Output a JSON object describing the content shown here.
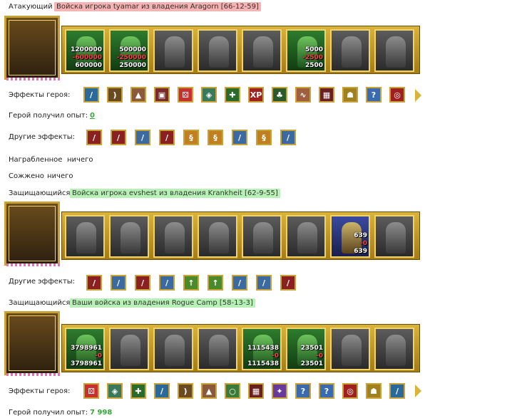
{
  "blocks": [
    {
      "role": "Атакующий",
      "title": "Войска игрока tyamar из владения Aragorn [66-12-59]",
      "tag": "red"
    },
    {
      "role": "Защищающийся",
      "title": "Войска игрока evshest из владения Krankheit [62-9-55]",
      "tag": "green"
    },
    {
      "role": "Защищающийся",
      "title": "Ваши войска из владения Rogue Camp [58-13-3]",
      "tag": "green"
    }
  ],
  "attacker": {
    "stacks": [
      {
        "numbers": [
          "1200000",
          "-600000",
          "600000"
        ]
      },
      {
        "numbers": [
          "500000",
          "-250000",
          "250000"
        ]
      },
      {
        "numbers": []
      },
      {
        "numbers": []
      },
      {
        "numbers": []
      },
      {
        "numbers": [
          "5000",
          "-2500",
          "2500"
        ]
      },
      {
        "numbers": []
      },
      {
        "numbers": []
      }
    ],
    "hero_effects_label": "Эффекты героя:",
    "hero_effects": [
      "sword-icon",
      "bow-icon",
      "boot-icon",
      "chest-icon",
      "dice-icon",
      "shield-icon",
      "shield-plus-icon",
      "xp-icon",
      "tree-icon",
      "horn-icon",
      "armor-icon",
      "amulet-icon",
      "question-icon",
      "chain-icon"
    ],
    "xp_label": "Герой получил опыт:",
    "xp_value": "0",
    "other_effects_label": "Другие эффекты:",
    "other_effects": [
      "sword-red-icon",
      "sword-red-icon",
      "sword-blue-icon",
      "sword-red-icon",
      "scroll-icon",
      "scroll-icon",
      "sword-blue-icon",
      "scroll-icon",
      "sword-blue-icon"
    ],
    "loot_label": "Награбленное",
    "loot_value": "ничего",
    "burned_label": "Сожжено",
    "burned_value": "ничего"
  },
  "defender1": {
    "stacks": [
      {
        "numbers": []
      },
      {
        "numbers": []
      },
      {
        "numbers": []
      },
      {
        "numbers": []
      },
      {
        "numbers": []
      },
      {
        "numbers": []
      },
      {
        "numbers": [
          "639",
          "-0",
          "639"
        ]
      },
      {
        "numbers": []
      }
    ],
    "other_effects_label": "Другие эффекты:",
    "other_effects": [
      "sword-red-icon",
      "sword-blue-icon",
      "sword-red-icon",
      "sword-blue-icon",
      "arrow-icon",
      "arrow-icon",
      "sword-blue-icon",
      "sword-blue-icon",
      "sword-red-icon"
    ]
  },
  "defender2": {
    "stacks": [
      {
        "numbers": [
          "3798961",
          "-0",
          "3798961"
        ]
      },
      {
        "numbers": []
      },
      {
        "numbers": []
      },
      {
        "numbers": []
      },
      {
        "numbers": [
          "1115438",
          "-0",
          "1115438"
        ]
      },
      {
        "numbers": [
          "23501",
          "-0",
          "23501"
        ]
      },
      {
        "numbers": []
      },
      {
        "numbers": []
      }
    ],
    "hero_effects_label": "Эффекты героя:",
    "hero_effects": [
      "dice-icon",
      "shield-icon",
      "shield-plus-icon",
      "sword-icon",
      "bow-icon",
      "boot-icon",
      "ring-icon",
      "armor-icon",
      "spell-icon",
      "question-icon",
      "question-icon",
      "chain-icon",
      "amulet-icon",
      "sword-icon"
    ],
    "xp_label": "Герой получил опыт:",
    "xp_value": "7 998"
  },
  "colors": {
    "gold": "#d9b33a",
    "red_tag": "#f5b4b4",
    "green_tag": "#b8f0b8",
    "xp": "#33aa33"
  }
}
